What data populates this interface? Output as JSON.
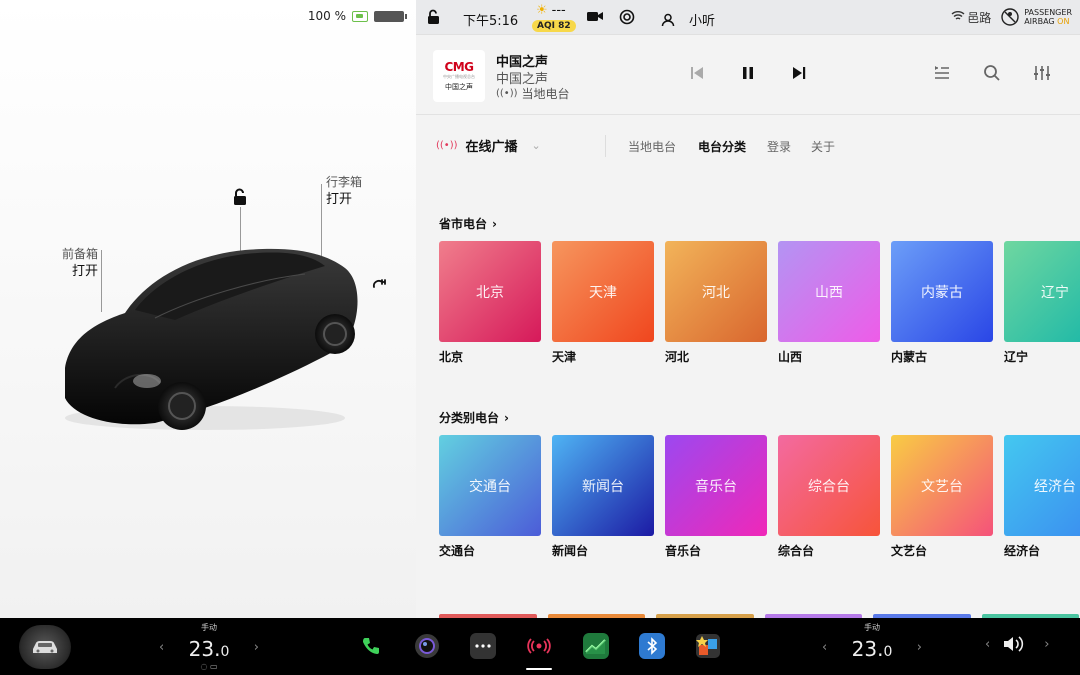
{
  "left_panel": {
    "battery_percent": "100 %",
    "trunk": {
      "label": "行李箱",
      "state": "打开"
    },
    "frunk": {
      "label": "前备箱",
      "state": "打开"
    }
  },
  "status_bar": {
    "time": "下午5:16",
    "weather_temp": "---",
    "aqi": "AQI 82",
    "user": "小听",
    "road_label": "邑路",
    "airbag": {
      "line1": "PASSENGER",
      "line2": "AIRBAG",
      "state": "ON"
    }
  },
  "now_playing": {
    "logo_text": "CMG",
    "logo_small": "中央广播电视总台",
    "logo_name": "中国之声",
    "title": "中国之声",
    "subtitle": "中国之声",
    "source": "当地电台"
  },
  "tabbar": {
    "source_label": "在线广播",
    "tabs": [
      {
        "label": "当地电台",
        "active": false
      },
      {
        "label": "电台分类",
        "active": true
      },
      {
        "label": "登录",
        "active": false
      },
      {
        "label": "关于",
        "active": false
      }
    ]
  },
  "sections": {
    "provincial": {
      "title": "省市电台",
      "tiles": [
        {
          "name": "北京",
          "caption": "北京",
          "grad": [
            "#f07e8c",
            "#d6195a"
          ]
        },
        {
          "name": "天津",
          "caption": "天津",
          "grad": [
            "#f6965e",
            "#f0461e"
          ]
        },
        {
          "name": "河北",
          "caption": "河北",
          "grad": [
            "#f2b45a",
            "#d9662e"
          ]
        },
        {
          "name": "山西",
          "caption": "山西",
          "grad": [
            "#b394f3",
            "#ee5ce8"
          ]
        },
        {
          "name": "内蒙古",
          "caption": "内蒙古",
          "grad": [
            "#6c9ef8",
            "#2a46e6"
          ]
        },
        {
          "name": "辽宁",
          "caption": "辽宁",
          "grad": [
            "#6fd7a0",
            "#18b6a8"
          ]
        }
      ]
    },
    "category": {
      "title": "分类别电台",
      "tiles": [
        {
          "name": "交通台",
          "caption": "交通台",
          "grad": [
            "#62d0e0",
            "#4c5cd8"
          ]
        },
        {
          "name": "新闻台",
          "caption": "新闻台",
          "grad": [
            "#4fb4f4",
            "#1c1aa4"
          ]
        },
        {
          "name": "音乐台",
          "caption": "音乐台",
          "grad": [
            "#9c48f0",
            "#f028b8"
          ]
        },
        {
          "name": "综合台",
          "caption": "综合台",
          "grad": [
            "#f36aa0",
            "#f7543a"
          ]
        },
        {
          "name": "文艺台",
          "caption": "文艺台",
          "grad": [
            "#f8cc44",
            "#f5527a"
          ]
        },
        {
          "name": "经济台",
          "caption": "经济台",
          "grad": [
            "#44c8f0",
            "#3a8af0"
          ]
        }
      ]
    },
    "peek_colors": [
      "#e05a5a",
      "#e98a3a",
      "#d6a04a",
      "#b57ae8",
      "#5a7ae8",
      "#4ac4a0"
    ]
  },
  "dock": {
    "climate_left": {
      "mode": "手动",
      "temp": "23.",
      "temp_dec": "0"
    },
    "climate_right": {
      "mode": "手动",
      "temp": "23.",
      "temp_dec": "0"
    },
    "apps": [
      "phone-icon",
      "camera-icon",
      "more-icon",
      "radio-icon",
      "stocks-icon",
      "bluetooth-icon",
      "game-icon"
    ]
  }
}
